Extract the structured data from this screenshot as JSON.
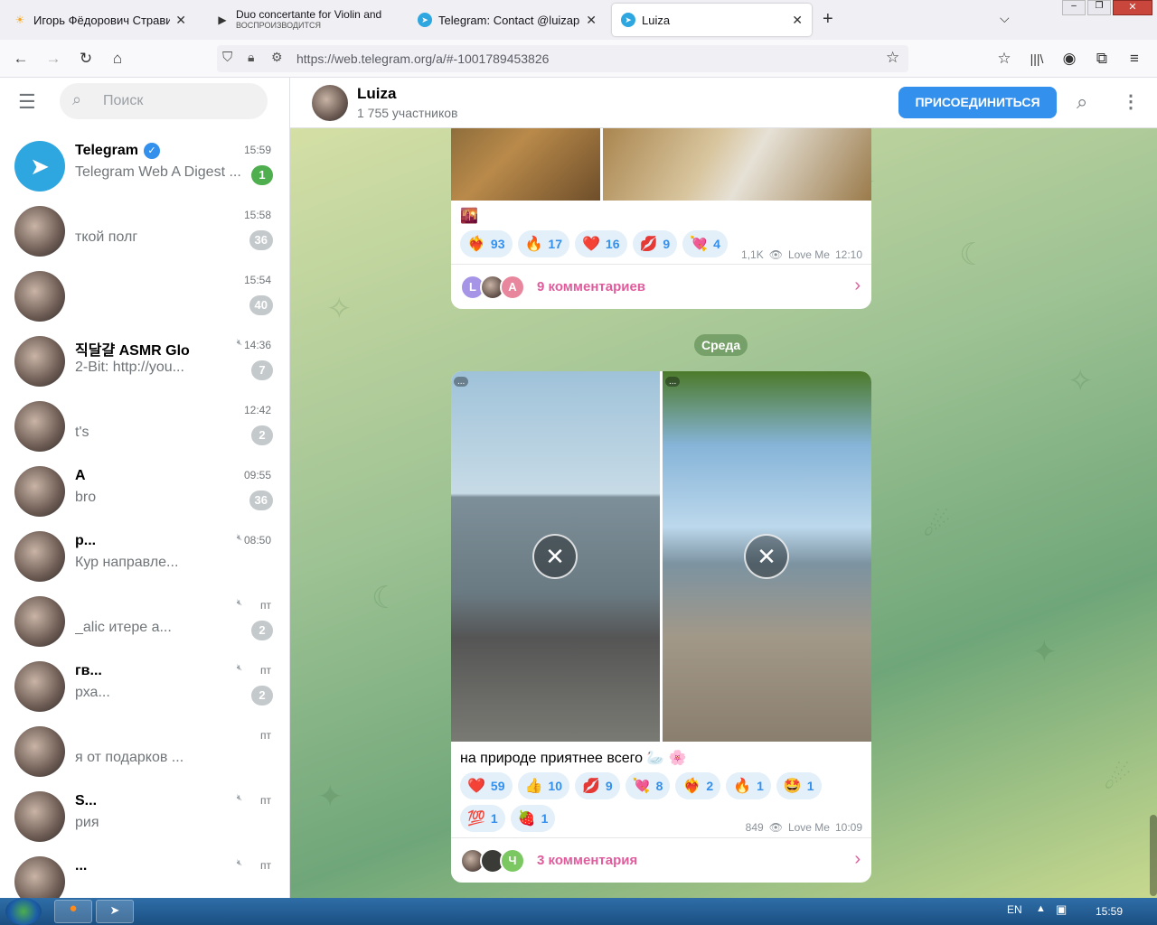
{
  "tabs": [
    {
      "title": "Игорь Фёдорович Стравински",
      "icon": "sun-icon",
      "color": "#f5a623"
    },
    {
      "title": "Duo concertante for Violin and",
      "subtitle": "ВОСПРОИЗВОДИТСЯ",
      "icon": "play-icon"
    },
    {
      "title": "Telegram: Contact @luizapip",
      "icon": "telegram-icon"
    },
    {
      "title": "Luiza",
      "icon": "telegram-icon"
    }
  ],
  "nav": {
    "url": "https://web.telegram.org/a/#-1001789453826"
  },
  "sidebar": {
    "search_placeholder": "Поиск",
    "chats": [
      {
        "name": "Telegram",
        "msg": "Telegram Web A Digest ...",
        "time": "15:59",
        "badge": "1",
        "verified": true
      },
      {
        "name": "",
        "msg": "ткой полг",
        "time": "15:58",
        "badge": "36"
      },
      {
        "name": "",
        "msg": "",
        "time": "15:54",
        "badge": "40"
      },
      {
        "name": "직달걀 ASMR Glo",
        "msg": "2-Bit: http://you...",
        "time": "14:36",
        "badge": "7",
        "muted": true
      },
      {
        "name": "",
        "msg": "t's",
        "time": "12:42",
        "badge": "2"
      },
      {
        "name": "A",
        "msg": "bro",
        "time": "09:55",
        "badge": "36"
      },
      {
        "name": "p...",
        "msg": "Кур     направле...",
        "time": "08:50",
        "badge": "",
        "muted": true
      },
      {
        "name": "",
        "msg": "_alic     итере а...",
        "time": "пт",
        "badge": "2",
        "muted": true
      },
      {
        "name": "гв...",
        "msg": "рха...",
        "time": "пт",
        "badge": "2",
        "muted": true
      },
      {
        "name": "",
        "msg": "я от подарков ...",
        "time": "пт",
        "badge": ""
      },
      {
        "name": "S...",
        "msg": "рия",
        "time": "пт",
        "badge": "",
        "muted": true
      },
      {
        "name": "...",
        "msg": "",
        "time": "пт",
        "badge": "",
        "muted": true
      }
    ]
  },
  "header": {
    "title": "Luiza",
    "subtitle": "1 755 участников",
    "join_label": "ПРИСОЕДИНИТЬСЯ"
  },
  "post1": {
    "caption": "🌇",
    "reactions": [
      {
        "e": "❤️‍🔥",
        "n": "93"
      },
      {
        "e": "🔥",
        "n": "17"
      },
      {
        "e": "❤️",
        "n": "16"
      },
      {
        "e": "💋",
        "n": "9"
      },
      {
        "e": "💘",
        "n": "4"
      }
    ],
    "views": "1,1K",
    "author": "Love Me",
    "time": "12:10",
    "commenters": [
      "L",
      "",
      "A"
    ],
    "comments": "9 комментариев"
  },
  "date_pill": "Среда",
  "post2": {
    "caption": "на природе приятнее всего 🦢 🌸",
    "reactions": [
      {
        "e": "❤️",
        "n": "59"
      },
      {
        "e": "👍",
        "n": "10"
      },
      {
        "e": "💋",
        "n": "9"
      },
      {
        "e": "💘",
        "n": "8"
      },
      {
        "e": "❤️‍🔥",
        "n": "2"
      },
      {
        "e": "🔥",
        "n": "1"
      },
      {
        "e": "🤩",
        "n": "1"
      }
    ],
    "reactions2": [
      {
        "e": "💯",
        "n": "1"
      },
      {
        "e": "🍓",
        "n": "1"
      }
    ],
    "views": "849",
    "author": "Love Me",
    "time": "10:09",
    "commenters": [
      "",
      "",
      "Ч"
    ],
    "comments": "3 комментария",
    "media_badges": [
      "...",
      "..."
    ]
  },
  "taskbar": {
    "lang": "EN",
    "clock": "15:59"
  }
}
